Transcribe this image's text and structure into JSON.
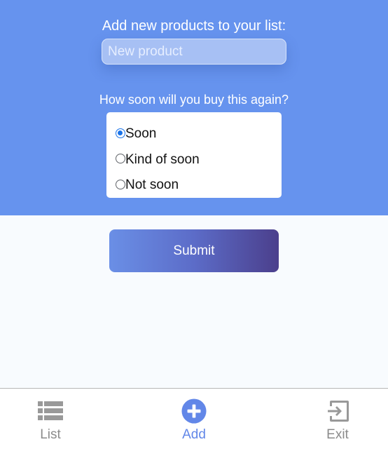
{
  "form": {
    "add_label": "Add new products to your list:",
    "input_placeholder": "New product",
    "input_value": "",
    "question": "How soon will you buy this again?",
    "options": [
      {
        "label": "Soon",
        "selected": true
      },
      {
        "label": "Kind of soon",
        "selected": false
      },
      {
        "label": "Not soon",
        "selected": false
      }
    ],
    "submit_label": "Submit"
  },
  "nav": {
    "items": [
      {
        "label": "List",
        "icon": "list-icon",
        "active": false
      },
      {
        "label": "Add",
        "icon": "add-circle-icon",
        "active": true
      },
      {
        "label": "Exit",
        "icon": "exit-icon",
        "active": false
      }
    ]
  },
  "colors": {
    "primary": "#6693ee",
    "background": "#f8fbfe",
    "active_nav": "#6287e8",
    "inactive_nav": "#8b8b8b",
    "radio_selected": "#1a73e8",
    "submit_gradient_start": "#6a8fe6",
    "submit_gradient_end": "#4b3f8c"
  }
}
